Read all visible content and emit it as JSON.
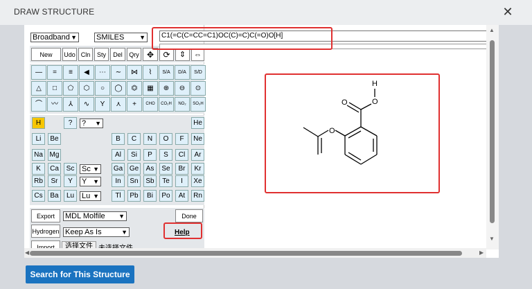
{
  "dialog": {
    "title": "DRAW STRUCTURE",
    "close_glyph": "✕"
  },
  "top_selects": {
    "format_selected": "Broadband",
    "notation_selected": "SMILES"
  },
  "smiles_value": "C1(=C(C=CC=C1)OC(C)=C)C(=O)O[H]",
  "toolbar_labels": [
    "New",
    "Udo",
    "Cln",
    "Sty",
    "Del",
    "Qry"
  ],
  "tool_text": [
    "S/A",
    "D/A",
    "S/D",
    "CHO",
    "CO₂H",
    "NO₂",
    "SO₃H"
  ],
  "elements": {
    "row1": [
      "H",
      "?",
      "He"
    ],
    "picker1": "?",
    "row2": [
      "Li",
      "Be",
      "B",
      "C",
      "N",
      "O",
      "F",
      "Ne"
    ],
    "row3": [
      "Na",
      "Mg",
      "Al",
      "Si",
      "P",
      "S",
      "Cl",
      "Ar"
    ],
    "row4": [
      "K",
      "Ca",
      "Sc",
      "Ga",
      "Ge",
      "As",
      "Se",
      "Br",
      "Kr"
    ],
    "picker4": "Sc",
    "row5": [
      "Rb",
      "Sr",
      "Y",
      "In",
      "Sn",
      "Sb",
      "Te",
      "I",
      "Xe"
    ],
    "picker5": "Y",
    "row6": [
      "Cs",
      "Ba",
      "Lu",
      "Tl",
      "Pb",
      "Bi",
      "Po",
      "At",
      "Rn"
    ],
    "picker6": "Lu"
  },
  "bottom": {
    "export_label": "Export",
    "export_format": "MDL Molfile",
    "done_label": "Done",
    "hydrogen_label": "Hydrogen",
    "hydrogen_mode": "Keep As Is",
    "help_label": "Help",
    "import_label": "Import",
    "file_button": "选择文件",
    "file_status": "未选择文件"
  },
  "molecule_atoms": {
    "h": "H",
    "o_acid": "O",
    "o_ether": "O"
  },
  "submit_label": "Search for This Structure",
  "colors": {
    "highlight": "#e03030",
    "submit_bg": "#1a73c0",
    "h_selected": "#f7c600",
    "tool_bg": "#dff0fa"
  }
}
